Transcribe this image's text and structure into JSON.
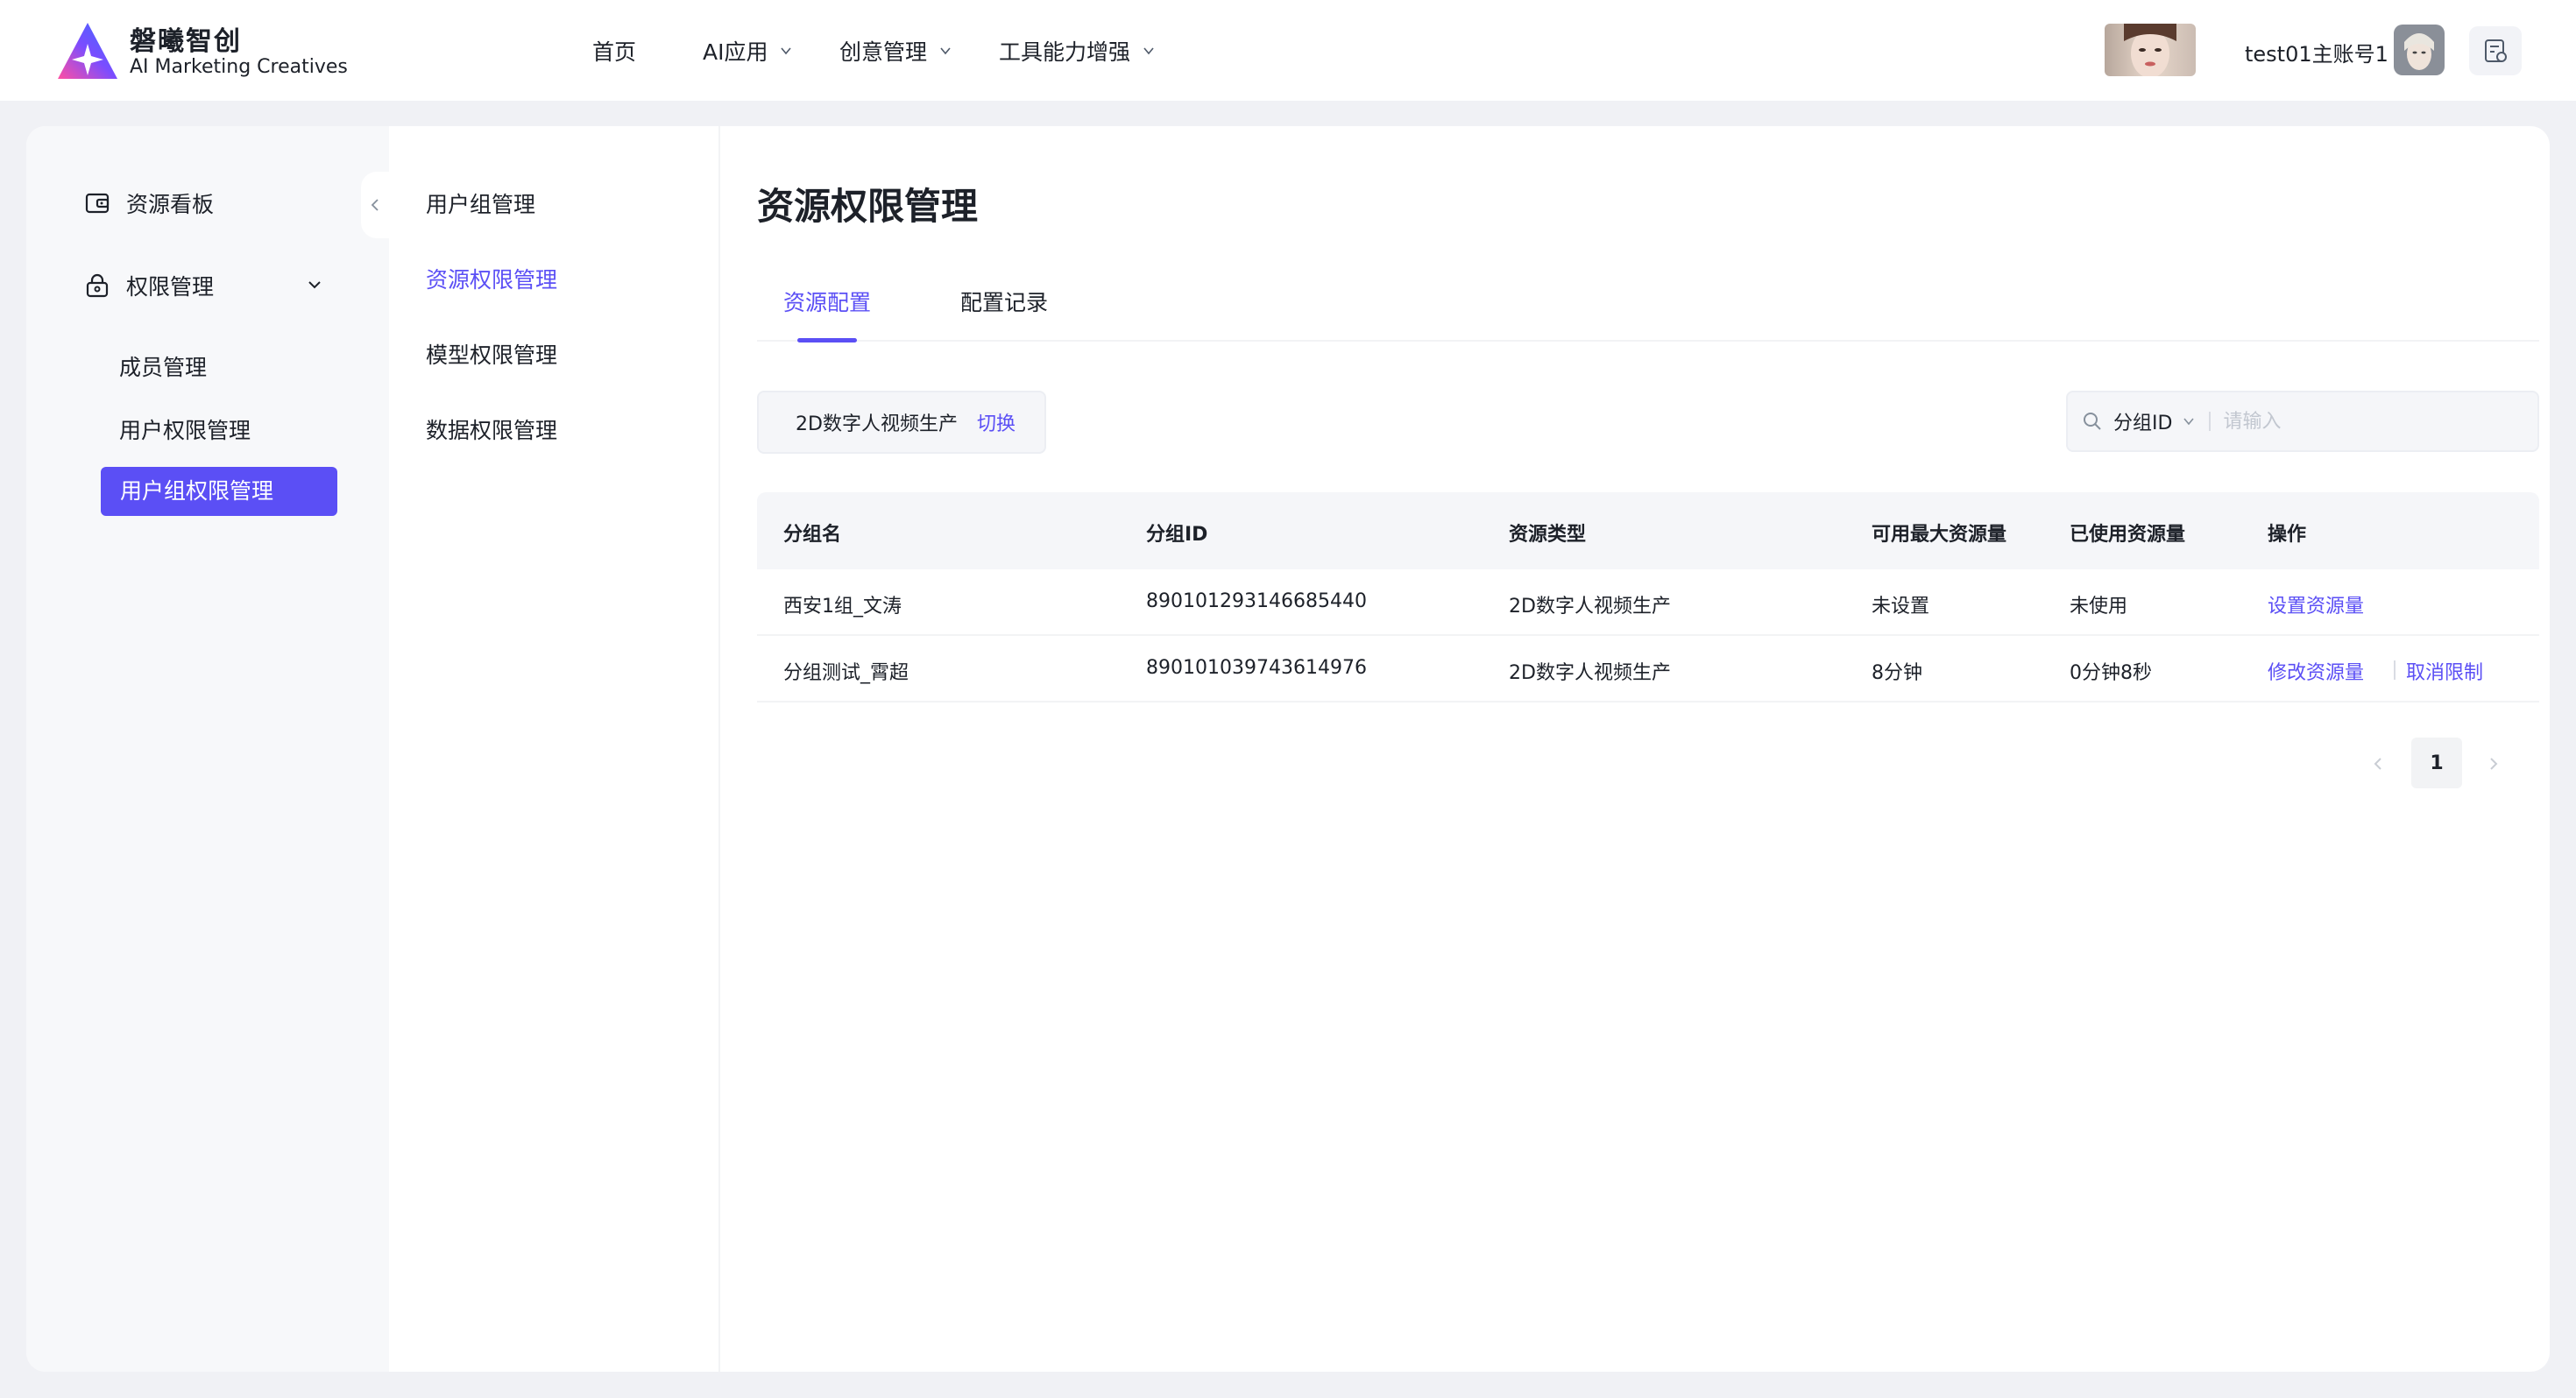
{
  "brand": {
    "name_cn": "磐曦智创",
    "name_en": "AI Marketing Creatives"
  },
  "nav": [
    {
      "label": "首页",
      "has_dropdown": false
    },
    {
      "label": "AI应用",
      "has_dropdown": true
    },
    {
      "label": "创意管理",
      "has_dropdown": true
    },
    {
      "label": "工具能力增强",
      "has_dropdown": true
    }
  ],
  "user": {
    "name": "test01主账号1"
  },
  "sidebar": {
    "items": [
      {
        "label": "资源看板",
        "icon": "wallet-icon"
      },
      {
        "label": "权限管理",
        "icon": "lock-icon",
        "expanded": true
      }
    ],
    "sub_items": [
      {
        "label": "成员管理"
      },
      {
        "label": "用户权限管理"
      },
      {
        "label": "用户组权限管理",
        "active": true
      }
    ]
  },
  "subnav": [
    {
      "label": "用户组管理"
    },
    {
      "label": "资源权限管理",
      "active": true
    },
    {
      "label": "模型权限管理"
    },
    {
      "label": "数据权限管理"
    }
  ],
  "page": {
    "title": "资源权限管理"
  },
  "tabs": [
    {
      "label": "资源配置",
      "active": true
    },
    {
      "label": "配置记录"
    }
  ],
  "resource_switch": {
    "current": "2D数字人视频生产",
    "switch_label": "切换"
  },
  "search": {
    "field": "分组ID",
    "placeholder": "请输入"
  },
  "table": {
    "columns": [
      "分组名",
      "分组ID",
      "资源类型",
      "可用最大资源量",
      "已使用资源量",
      "操作"
    ],
    "rows": [
      {
        "group_name": "西安1组_文涛",
        "group_id": "890101293146685440",
        "resource_type": "2D数字人视频生产",
        "max_quota": "未设置",
        "used": "未使用",
        "actions": [
          "设置资源量"
        ]
      },
      {
        "group_name": "分组测试_霄超",
        "group_id": "890101039743614976",
        "resource_type": "2D数字人视频生产",
        "max_quota": "8分钟",
        "used": "0分钟8秒",
        "actions": [
          "修改资源量",
          "取消限制"
        ]
      }
    ]
  },
  "pagination": {
    "current_page": "1"
  },
  "colors": {
    "accent": "#5b4ff5",
    "page_bg": "#f0f1f5",
    "sidebar_bg": "#f7f8fa"
  }
}
